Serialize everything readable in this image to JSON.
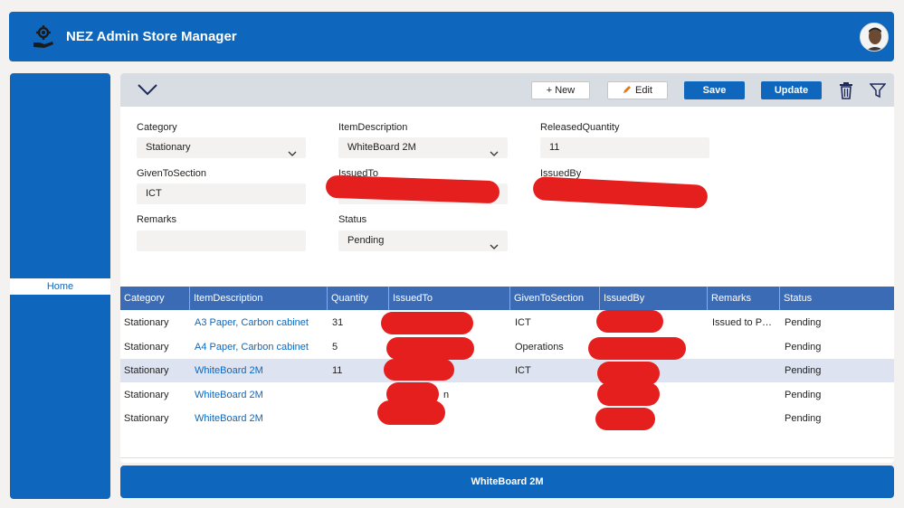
{
  "header": {
    "title": "NEZ Admin Store Manager",
    "logo_icon": "gear-hand-icon",
    "avatar_icon": "user-avatar"
  },
  "sidebar": {
    "items": [
      {
        "label": "Home"
      }
    ]
  },
  "toolbar": {
    "collapse_icon": "chevron-down-icon",
    "new_label": "+ New",
    "edit_label": "Edit",
    "save_label": "Save",
    "update_label": "Update",
    "delete_icon": "trash-icon",
    "filter_icon": "filter-icon"
  },
  "form": {
    "category": {
      "label": "Category",
      "value": "Stationary"
    },
    "item_description": {
      "label": "ItemDescription",
      "value": "WhiteBoard 2M"
    },
    "released_quantity": {
      "label": "ReleasedQuantity",
      "value": "11"
    },
    "given_to_section": {
      "label": "GivenToSection",
      "value": "ICT"
    },
    "issued_to": {
      "label": "IssuedTo",
      "value": ""
    },
    "issued_by": {
      "label": "IssuedBy",
      "value": ""
    },
    "remarks": {
      "label": "Remarks",
      "value": ""
    },
    "status": {
      "label": "Status",
      "value": "Pending"
    }
  },
  "table": {
    "columns": [
      "Category",
      "ItemDescription",
      "Quantity",
      "IssuedTo",
      "GivenToSection",
      "IssuedBy",
      "Remarks",
      "Status"
    ],
    "rows": [
      {
        "category": "Stationary",
        "item": "A3 Paper, Carbon cabinet",
        "quantity": "31",
        "issued_to": "",
        "section": "ICT",
        "issued_by": "",
        "remarks": "Issued to PME...",
        "status": "Pending"
      },
      {
        "category": "Stationary",
        "item": "A4 Paper, Carbon cabinet",
        "quantity": "5",
        "issued_to": "",
        "section": "Operations",
        "issued_by": "",
        "remarks": "",
        "status": "Pending"
      },
      {
        "category": "Stationary",
        "item": "WhiteBoard 2M",
        "quantity": "11",
        "issued_to": "",
        "section": "ICT",
        "issued_by": "",
        "remarks": "",
        "status": "Pending"
      },
      {
        "category": "Stationary",
        "item": "WhiteBoard 2M",
        "quantity": "",
        "issued_to": "n",
        "section": "",
        "issued_by": "",
        "remarks": "",
        "status": "Pending"
      },
      {
        "category": "Stationary",
        "item": "WhiteBoard 2M",
        "quantity": "",
        "issued_to": "",
        "section": "",
        "issued_by": "",
        "remarks": "",
        "status": "Pending"
      }
    ]
  },
  "footer": {
    "label": "WhiteBoard 2M"
  },
  "colors": {
    "primary": "#0f67bd",
    "table_header": "#3c6bb6",
    "selected_row": "#dde3f1",
    "redaction": "#e51e1e"
  }
}
